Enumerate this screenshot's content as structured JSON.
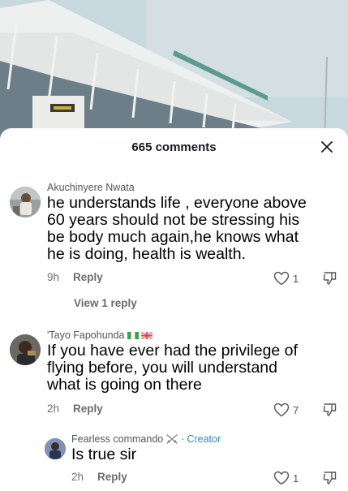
{
  "header": {
    "comments_count": "665 comments"
  },
  "comments": [
    {
      "author": "Akuchinyere Nwata",
      "text_lines": [
        "he understands life , everyone above",
        "60 years should not be stressing his",
        "be body much again,he knows what",
        "he is doing, health is wealth."
      ],
      "time": "9h",
      "reply_label": "Reply",
      "likes": "1",
      "view_replies": "View 1 reply"
    },
    {
      "author": "'Tayo Fapohunda",
      "text_lines": [
        "If you have ever had the privilege of",
        "flying before, you will understand",
        "what is going on there"
      ],
      "time": "2h",
      "reply_label": "Reply",
      "likes": "7"
    }
  ],
  "reply": {
    "author": "Fearless commando",
    "separator": "·",
    "creator_label": "Creator",
    "text": "Is true sir",
    "time": "2h",
    "reply_label": "Reply",
    "likes": "1"
  },
  "icons": {
    "close": "close-icon",
    "heart": "heart-outline-icon",
    "dislike": "thumbs-down-icon"
  }
}
